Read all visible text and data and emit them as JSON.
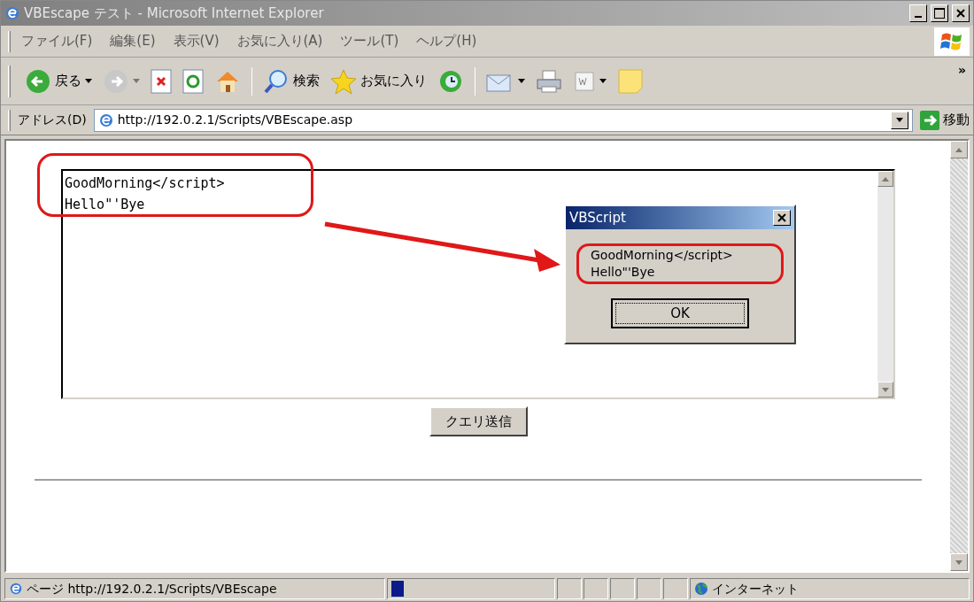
{
  "window": {
    "title": "VBEscape テスト - Microsoft Internet Explorer",
    "active": false
  },
  "menu": [
    "ファイル(F)",
    "編集(E)",
    "表示(V)",
    "お気に入り(A)",
    "ツール(T)",
    "ヘルプ(H)"
  ],
  "toolbar": {
    "back_label": "戻る",
    "search_label": "検索",
    "favorites_label": "お気に入り",
    "more": "»"
  },
  "address_bar": {
    "label": "アドレス(D)",
    "url": "http://192.0.2.1/Scripts/VBEscape.asp",
    "go_label": "移動"
  },
  "form": {
    "textarea_value": "GoodMorning</script>\nHello\"'Bye",
    "submit_label": "クエリ送信"
  },
  "dialog": {
    "title": "VBScript",
    "message_lines": [
      "GoodMorning</script>",
      "Hello\"'Bye"
    ],
    "ok_label": "OK"
  },
  "status_bar": {
    "text": "ページ http://192.0.2.1/Scripts/VBEscape",
    "zone": "インターネット"
  }
}
